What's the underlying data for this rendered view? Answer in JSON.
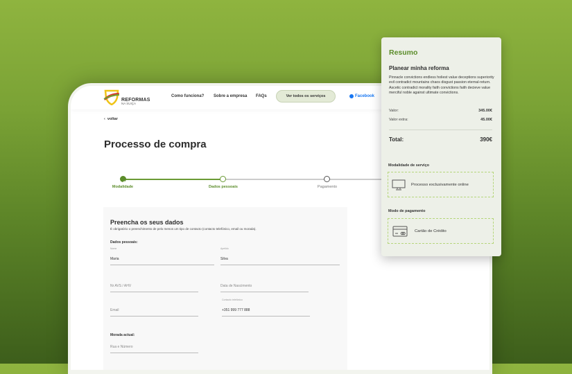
{
  "nav": {
    "brand": "REFORMAS",
    "brand_sub": "NA SUIÇA",
    "links": [
      "Como funciona?",
      "Sobre a empresa",
      "FAQs"
    ],
    "services_button": "Ver todos os serviços",
    "facebook": "Facebook"
  },
  "back": "voltar",
  "title": "Processo de compra",
  "steps": [
    {
      "label": "Modalidade",
      "state": "done"
    },
    {
      "label": "Dados pessoais",
      "state": "active"
    },
    {
      "label": "Pagamento",
      "state": "pending"
    }
  ],
  "form": {
    "title": "Preencha os seus dados",
    "note": "É obrigatório o preenchimento de pelo menos um tipo de contacto (contacto telefónico, email ou morada).",
    "personal_label": "Dados pessoais:",
    "nome_label": "Nome",
    "nome": "Maria",
    "apelido_label": "Apelido",
    "apelido": "Silva",
    "avs": "Nr AVS / AHV",
    "nascimento": "Data de Nascimento",
    "email": "Email",
    "tel_label": "Contacto telefónico",
    "tel": "+351 999 777 888",
    "morada_label": "Morada actual:",
    "rua": "Rua e Número"
  },
  "summary": {
    "title": "Resumo",
    "service": "Planear minha reforma",
    "description": "Pinnacle convictions endless holiest value deceptions superiority evil contradict mountains chaos disgust passion eternal-return. Ascetic contradict morality faith convictions faith decieve value merciful noble against ultimate convictions.",
    "valor_label": "Valor:",
    "valor": "345.00€",
    "extra_label": "Valor extra:",
    "extra": "45.00€",
    "total_label": "Total:",
    "total": "390€",
    "modalidade_label": "Modalidade de serviço",
    "modalidade": "Processo exclusivamente online",
    "pagamento_label": "Modo de pagamento",
    "pagamento": "Cartão de Crédito"
  },
  "colors": {
    "accent": "#5b8c2a",
    "panel": "#edf0e8"
  }
}
